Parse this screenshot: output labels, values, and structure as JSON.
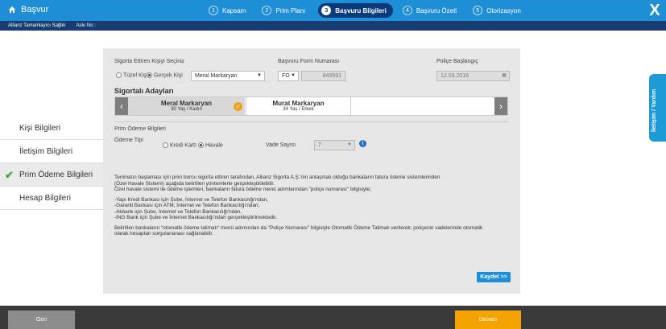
{
  "header": {
    "home_label": "Başvur",
    "steps": [
      {
        "num": "1",
        "label": "Kapsam"
      },
      {
        "num": "2",
        "label": "Prim Planı"
      },
      {
        "num": "3",
        "label": "Başvuru Bilgileri"
      },
      {
        "num": "4",
        "label": "Başvuru Özeti"
      },
      {
        "num": "5",
        "label": "Otorizasyon"
      }
    ],
    "close_label": "X"
  },
  "subbar": {
    "product": "Allianz Tamamlayıcı Sağlık",
    "ask_no": "Askı No :"
  },
  "sidebar": {
    "items": [
      {
        "label": "Kişi Bilgileri"
      },
      {
        "label": "İletişim Bilgileri"
      },
      {
        "label": "Prim Ödeme Bilgileri"
      },
      {
        "label": "Hesap Bilgileri"
      }
    ]
  },
  "form": {
    "insurer_label": "Sigorta Ettiren Kişiyi Seçiniz",
    "legal_label": "Tüzel Kişi",
    "real_label": "Gerçek Kişi",
    "person_value": "Meral Markaryan",
    "form_no_label": "Başvuru Form Numarası",
    "form_prefix": "FO",
    "form_no": "849591",
    "policy_start_label": "Poliçe Başlangıç",
    "policy_start": "12.03.2016",
    "candidates_title": "Sigortalı Adayları",
    "candidates": [
      {
        "name": "Meral Markaryan",
        "info": "30 Yaş / Kadın"
      },
      {
        "name": "Murat Markaryan",
        "info": "34 Yaş / Erkek"
      }
    ],
    "payment_info_label": "Prim Ödeme Bilgileri",
    "payment_type_label": "Ödeme Tipi",
    "card_label": "Kredi Kartı",
    "transfer_label": "Havale",
    "installments_label": "Vade Sayısı",
    "installments_value": "7",
    "info_icon": "i",
    "save_label": "Kaydet >>"
  },
  "notice": {
    "p1": "Teminatın başlaması için prim borcu sigorta ettiren tarafından, Allianz Sigorta A.Ş.'nin anlaşmalı olduğu bankaların fatura ödeme sistemlerinden",
    "p2": "(Özel Havale Sistemi) aşağıda belirtilen yöntemlerle gerçekleştirilebilir.",
    "p3": "Özel havale sistemi ile ödeme işlemleri, bankaların fatura ödeme menü adımlarından \"poliçe numarası\" bilgisiyle;",
    "l1": "-Yapı Kredi Bankası için Şube, İnternet ve Telefon Bankacılığı'ndan,",
    "l2": "-Garanti Bankası için ATM, İnternet ve Telefon Bankacılığı'ndan,",
    "l3": "-Akbank için Şube, İnternet ve Telefon Bankacılığı'ndan,",
    "l4": "-ING Bank için Şube ve İnternet Bankacılığı'ndan gerçekleştirilmektedir.",
    "p4": "Belirtilen bankaların \"otomatik ödeme talimatı\" menü adımından da \"Poliçe Numarası\" bilgisiyle Otomatik Ödeme Talimatı verilerek; poliçenin vadelerinde otomatik olarak hesaptan sorgulananası sağlanabilir."
  },
  "help_label": "İletişim / Yardım",
  "footer": {
    "back_label": "Geri",
    "next_label": "Devam"
  }
}
